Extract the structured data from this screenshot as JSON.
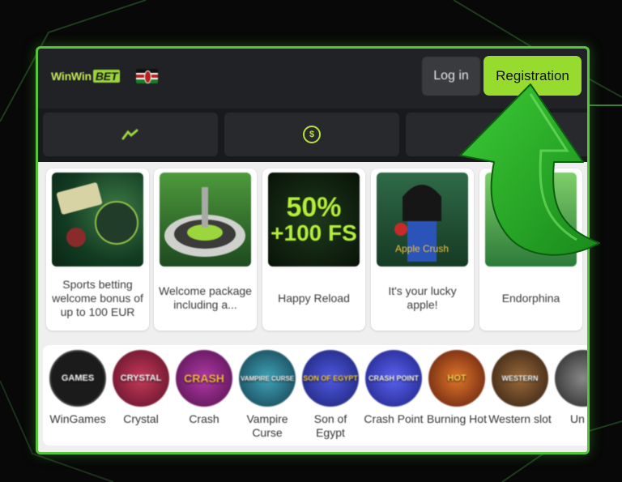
{
  "header": {
    "logo_text": "WinWin",
    "logo_badge": "BET",
    "login_label": "Log in",
    "register_label": "Registration"
  },
  "tabs": [
    {
      "icon": "sports-icon"
    },
    {
      "icon": "casino-chip-icon"
    },
    {
      "icon": "more-icon"
    }
  ],
  "promos": [
    {
      "title": "Sports betting welcome bonus of up to 100 EUR",
      "title_display": "Sports betting welcome bonus of up to 100 EUR"
    },
    {
      "title": "Welcome package including a...",
      "title_display": "Welcome package including a..."
    },
    {
      "title": "Happy Reload",
      "banner_text_1": "50%",
      "banner_text_2": "+100 FS"
    },
    {
      "title": "It's your lucky apple!",
      "banner_text": "Apple Crush"
    },
    {
      "title": "Endorphina"
    }
  ],
  "games": [
    {
      "label": "WinGames",
      "art_text": "GAMES",
      "color": "#1b1b1b"
    },
    {
      "label": "Crystal",
      "art_text": "CRYSTAL",
      "color": "#8a1e3a"
    },
    {
      "label": "Crash",
      "art_text": "CRASH",
      "color": "#7a1e6b"
    },
    {
      "label": "Vampire Curse",
      "art_text": "VAMPIRE CURSE",
      "color": "#1e4f63"
    },
    {
      "label": "Son of Egypt",
      "art_text": "SON OF EGYPT",
      "color": "#2b2f9c"
    },
    {
      "label": "Crash Point",
      "art_text": "CRASH POINT",
      "color": "#2a2fa8"
    },
    {
      "label": "Burning Hot",
      "art_text": "HOT",
      "color": "#7a2b16"
    },
    {
      "label": "Western slot",
      "art_text": "WESTERN",
      "color": "#4a3220"
    },
    {
      "label": "Un C",
      "art_text": "",
      "color": "#333333"
    }
  ],
  "colors": {
    "accent": "#97db2e",
    "frame": "#57c53a",
    "header_bg": "#212225",
    "arrow": "#2fae2a"
  }
}
